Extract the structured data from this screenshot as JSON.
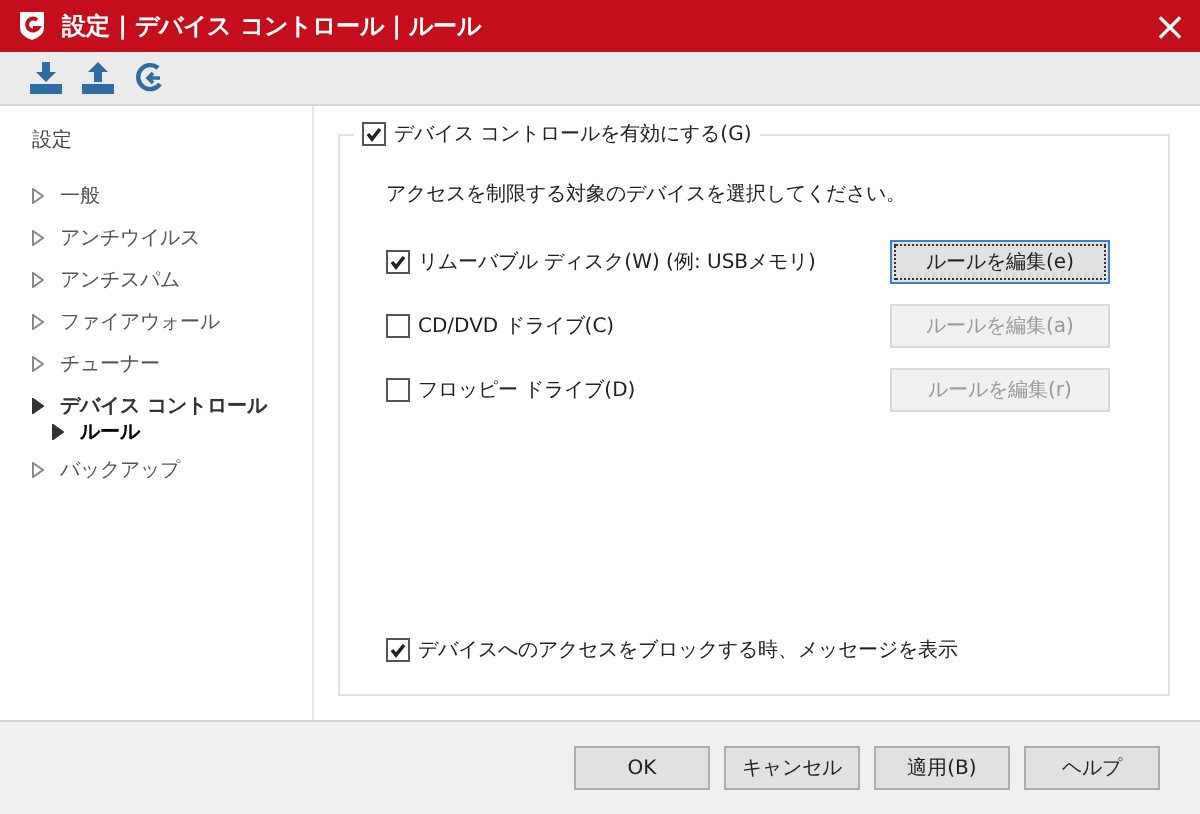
{
  "window": {
    "title": "設定 | デバイス コントロール | ルール",
    "close": "×"
  },
  "sidebar": {
    "heading": "設定",
    "items": [
      {
        "label": "一般",
        "expanded": false,
        "selected": false
      },
      {
        "label": "アンチウイルス",
        "expanded": false,
        "selected": false
      },
      {
        "label": "アンチスパム",
        "expanded": false,
        "selected": false
      },
      {
        "label": "ファイアウォール",
        "expanded": false,
        "selected": false
      },
      {
        "label": "チューナー",
        "expanded": false,
        "selected": false
      },
      {
        "label": "デバイス コントロール",
        "expanded": true,
        "selected": false,
        "children": [
          {
            "label": "ルール",
            "expanded": true,
            "selected": true
          }
        ]
      },
      {
        "label": "バックアップ",
        "expanded": false,
        "selected": false
      }
    ]
  },
  "group": {
    "label": "デバイス コントロールを有効にする(G)",
    "checked": true,
    "instruction": "アクセスを制限する対象のデバイスを選択してください。",
    "devices": [
      {
        "label": "リムーバブル ディスク(W) (例: USBメモリ)",
        "checked": true,
        "button": "ルールを編集(e)",
        "disabled": false
      },
      {
        "label": "CD/DVD ドライブ(C)",
        "checked": false,
        "button": "ルールを編集(a)",
        "disabled": true
      },
      {
        "label": "フロッピー ドライブ(D)",
        "checked": false,
        "button": "ルールを編集(r)",
        "disabled": true
      }
    ],
    "message": {
      "label": "デバイスへのアクセスをブロックする時、メッセージを表示",
      "checked": true
    }
  },
  "buttons": [
    "OK",
    "キャンセル",
    "適用(B)",
    "ヘルプ"
  ]
}
